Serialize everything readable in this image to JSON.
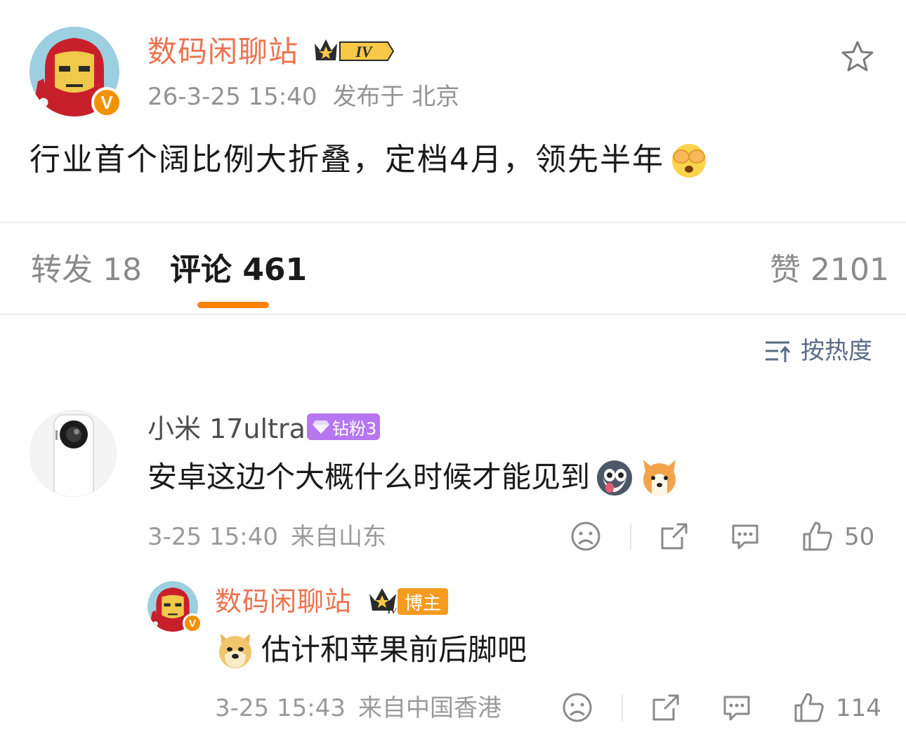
{
  "post": {
    "author": "数码闲聊站",
    "level_badge": "IV",
    "verified_mark": "V",
    "date": "26-3-25 15:40",
    "location": "发布于 北京",
    "text": "行业首个阔比例大折叠，定档4月，领先半年",
    "text_emoji": "face-covering-eyes-emoji",
    "favorite_icon": "star-outline-icon"
  },
  "tabs": {
    "repost": "转发 18",
    "comments": "评论 461",
    "likes": "赞 2101"
  },
  "sort": {
    "label": "按热度",
    "icon": "sort-icon"
  },
  "comments": [
    {
      "user": "小米 17ultra",
      "fan_badge": "钻粉3",
      "text": "安卓这边个大概什么时候才能见到",
      "emojis": [
        "husky-emoji",
        "corgi-emoji"
      ],
      "time": "3-25 15:40",
      "source": "来自山东",
      "likes": "50",
      "replies": [
        {
          "user": "数码闲聊站",
          "verified_mark": "V",
          "level_badge": "IV",
          "role_badge": "博主",
          "emoji": "doge-emoji",
          "text": "估计和苹果前后脚吧",
          "time": "3-25 15:43",
          "source": "来自中国香港",
          "likes": "114"
        }
      ]
    }
  ],
  "colors": {
    "author_orange": "#eb7350",
    "tab_underline": "#ff8200",
    "fan_badge": "#b676f0",
    "blogger_badge": "#f59b20",
    "verified": "#f29100"
  }
}
